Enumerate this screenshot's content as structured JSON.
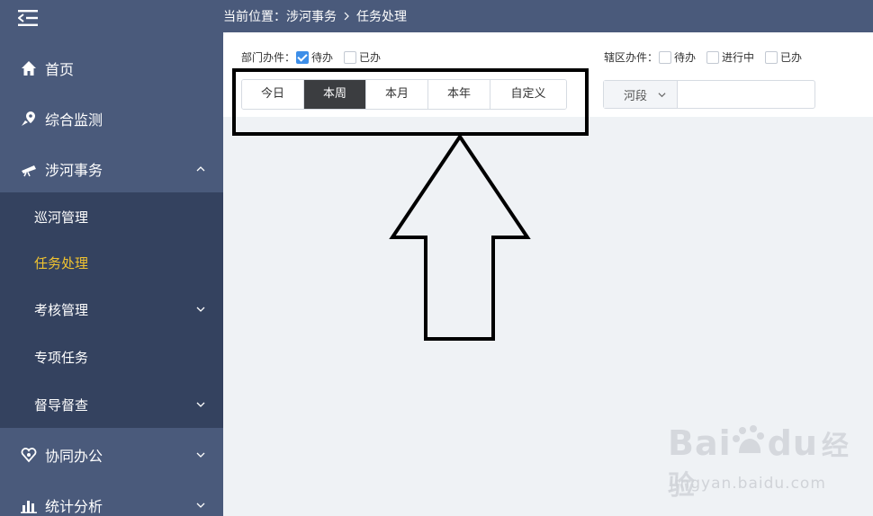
{
  "breadcrumb": {
    "prefix": "当前位置：",
    "section": "涉河事务",
    "current": "任务处理"
  },
  "sidebar": {
    "items": [
      {
        "label": "首页",
        "icon": "home-icon"
      },
      {
        "label": "综合监测",
        "icon": "location-pin-icon"
      },
      {
        "label": "涉河事务",
        "icon": "telescope-icon",
        "expanded": true
      },
      {
        "label": "协同办公",
        "icon": "heart-shield-icon"
      },
      {
        "label": "统计分析",
        "icon": "bar-chart-icon"
      }
    ],
    "submenu": [
      {
        "label": "巡河管理"
      },
      {
        "label": "任务处理",
        "active": true
      },
      {
        "label": "考核管理"
      },
      {
        "label": "专项任务"
      },
      {
        "label": "督导督查"
      }
    ]
  },
  "filters": {
    "dept": {
      "label": "部门办件：",
      "opt_pending": "待办",
      "opt_done": "已办",
      "pending_checked": true,
      "done_checked": false
    },
    "district": {
      "label": "辖区办件：",
      "opt_pending": "待办",
      "opt_progress": "进行中",
      "opt_done": "已办"
    },
    "periods": [
      "今日",
      "本周",
      "本月",
      "本年",
      "自定义"
    ],
    "selected_period": "本周",
    "select": {
      "label": "河段",
      "value": ""
    }
  },
  "watermark": {
    "brand": "Bai",
    "brand2": "du",
    "brand3": "经验",
    "url": "jingyan.baidu.com"
  },
  "colors": {
    "sidebar": "#4a5a7b",
    "submenu": "#34425f",
    "active": "#f0c330",
    "checkbox": "#3d8ee8",
    "segment_selected": "#3b3d40"
  }
}
